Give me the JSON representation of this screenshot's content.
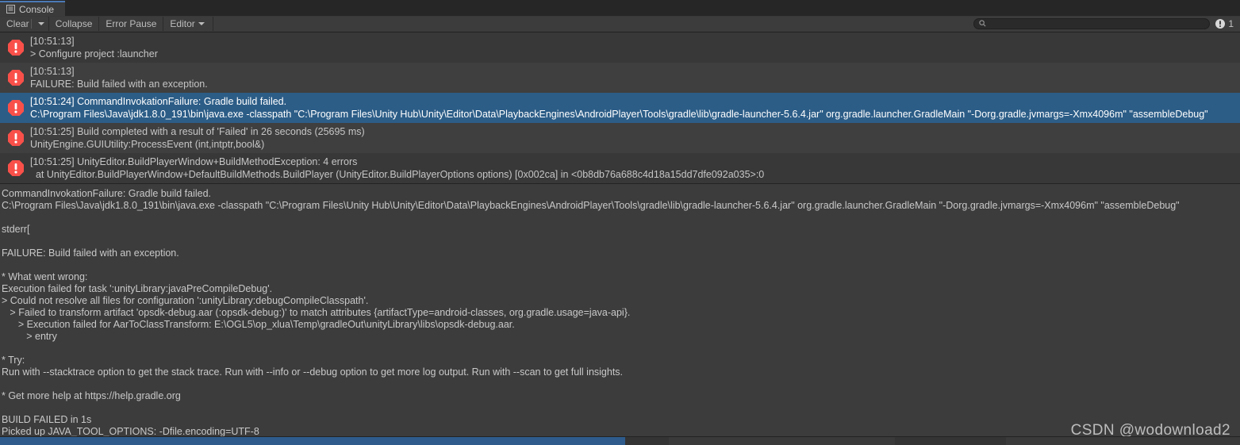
{
  "window": {
    "tab_label": "Console",
    "tab_icon": "console-list-icon"
  },
  "toolbar": {
    "clear_label": "Clear",
    "clear_dropdown_icon": "chevron-down-icon",
    "collapse_label": "Collapse",
    "error_pause_label": "Error Pause",
    "editor_label": "Editor",
    "editor_dropdown_icon": "chevron-down-icon",
    "search_placeholder": "",
    "search_value": "",
    "search_icon": "search-icon",
    "error_badge_icon": "error-circle-icon",
    "error_badge_count": "1"
  },
  "log_entries": [
    {
      "icon": "error-octagon-icon",
      "selected": false,
      "line1": "[10:51:13]",
      "line2": "> Configure project :launcher"
    },
    {
      "icon": "error-octagon-icon",
      "selected": false,
      "line1": "[10:51:13]",
      "line2": "FAILURE: Build failed with an exception."
    },
    {
      "icon": "error-octagon-icon",
      "selected": true,
      "line1": "[10:51:24] CommandInvokationFailure: Gradle build failed.",
      "line2": "C:\\Program Files\\Java\\jdk1.8.0_191\\bin\\java.exe -classpath \"C:\\Program Files\\Unity Hub\\Unity\\Editor\\Data\\PlaybackEngines\\AndroidPlayer\\Tools\\gradle\\lib\\gradle-launcher-5.6.4.jar\" org.gradle.launcher.GradleMain \"-Dorg.gradle.jvmargs=-Xmx4096m\" \"assembleDebug\""
    },
    {
      "icon": "error-octagon-icon",
      "selected": false,
      "line1": "[10:51:25] Build completed with a result of 'Failed' in 26 seconds (25695 ms)",
      "line2": "UnityEngine.GUIUtility:ProcessEvent (int,intptr,bool&)"
    },
    {
      "icon": "error-octagon-icon",
      "selected": false,
      "line1": "[10:51:25] UnityEditor.BuildPlayerWindow+BuildMethodException: 4 errors",
      "line2": "  at UnityEditor.BuildPlayerWindow+DefaultBuildMethods.BuildPlayer (UnityEditor.BuildPlayerOptions options) [0x002ca] in <0b8db76a688c4d18a15dd7dfe092a035>:0"
    }
  ],
  "detail_pane": {
    "lines": [
      "CommandInvokationFailure: Gradle build failed.",
      "C:\\Program Files\\Java\\jdk1.8.0_191\\bin\\java.exe -classpath \"C:\\Program Files\\Unity Hub\\Unity\\Editor\\Data\\PlaybackEngines\\AndroidPlayer\\Tools\\gradle\\lib\\gradle-launcher-5.6.4.jar\" org.gradle.launcher.GradleMain \"-Dorg.gradle.jvmargs=-Xmx4096m\" \"assembleDebug\"",
      "",
      "stderr[",
      "",
      "FAILURE: Build failed with an exception.",
      "",
      "* What went wrong:",
      "Execution failed for task ':unityLibrary:javaPreCompileDebug'.",
      "> Could not resolve all files for configuration ':unityLibrary:debugCompileClasspath'.",
      "   > Failed to transform artifact 'opsdk-debug.aar (:opsdk-debug:)' to match attributes {artifactType=android-classes, org.gradle.usage=java-api}.",
      "      > Execution failed for AarToClassTransform: E:\\OGL5\\op_xlua\\Temp\\gradleOut\\unityLibrary\\libs\\opsdk-debug.aar.",
      "         > entry",
      "",
      "* Try:",
      "Run with --stacktrace option to get the stack trace. Run with --info or --debug option to get more log output. Run with --scan to get full insights.",
      "",
      "* Get more help at https://help.gradle.org",
      "",
      "BUILD FAILED in 1s",
      "Picked up JAVA_TOOL_OPTIONS: -Dfile.encoding=UTF-8"
    ]
  },
  "watermark": {
    "text": "CSDN @wodownload2"
  },
  "colors": {
    "selection_blue": "#2c5d87",
    "error_red": "#f9504a",
    "tab_accent": "#4b7ab5",
    "scrollbar_thumb": "#2e5b8c"
  }
}
